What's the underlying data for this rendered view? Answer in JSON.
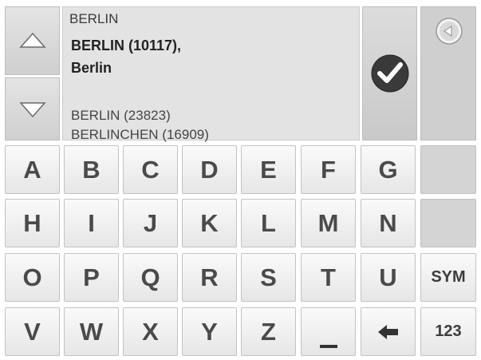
{
  "search": {
    "input_value": "BERLIN",
    "selected_line1": "BERLIN (10117),",
    "selected_line2": "Berlin",
    "other_results": [
      "BERLIN (23823)",
      "BERLINCHEN (16909)"
    ]
  },
  "keyboard": {
    "row1": [
      "A",
      "B",
      "C",
      "D",
      "E",
      "F",
      "G"
    ],
    "row2": [
      "H",
      "I",
      "J",
      "K",
      "L",
      "M",
      "N"
    ],
    "row3": [
      "O",
      "P",
      "Q",
      "R",
      "S",
      "T",
      "U"
    ],
    "row4": [
      "V",
      "W",
      "X",
      "Y",
      "Z"
    ],
    "sym_label": "SYM",
    "num_label": "123"
  },
  "icons": {
    "scroll_up": "triangle-up-icon",
    "scroll_down": "triangle-down-icon",
    "confirm": "checkmark-icon",
    "back": "back-arrow-icon",
    "backspace": "left-arrow-icon",
    "space": "underscore-icon"
  }
}
